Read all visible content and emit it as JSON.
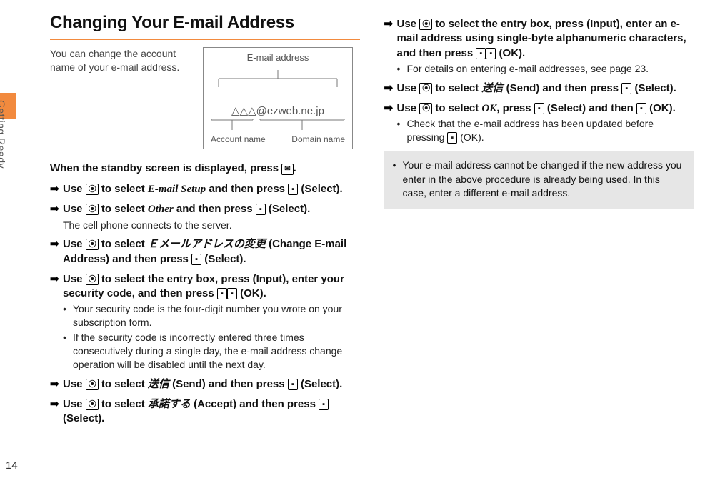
{
  "spine": {
    "section": "Getting Ready",
    "pagenum": "14"
  },
  "title": "Changing Your E-mail Address",
  "intro": "You can change the account name of your e-mail address.",
  "diagram": {
    "heading": "E-mail address",
    "addr": "△△△@ezweb.ne.jp",
    "label_left": "Account name",
    "label_right": "Domain name"
  },
  "leadline_pre": "When the standby screen is displayed, press ",
  "leadline_post": ".",
  "icons": {
    "nav": "⦿",
    "center": "▪",
    "mail": "✉"
  },
  "steps_left": [
    {
      "pre": "Use ",
      "icon": "nav",
      "mid1": " to select ",
      "ital": "E-mail Setup",
      "italClass": "italic-serif",
      "mid2": " and then  press ",
      "icon2": "center",
      "post": " (Select)."
    },
    {
      "pre": "Use ",
      "icon": "nav",
      "mid1": " to select ",
      "ital": "Other",
      "italClass": "italic-serif",
      "mid2": " and then press ",
      "icon2": "center",
      "post": " (Select).",
      "sub_plain": "The cell phone connects to the server."
    },
    {
      "pre": "Use ",
      "icon": "nav",
      "mid1": " to select ",
      "ital": "Ｅメールアドレスの変更",
      "italClass": "italic-sans",
      "paren": " (Change E-mail Address)",
      "mid2": " and then press ",
      "icon2": "center",
      "post": " (Select)."
    },
    {
      "pre": "Use ",
      "icon": "nav",
      "mid1": " to select the entry box, press ",
      "icon2": "center",
      "mid2": " (Input), enter your security code, and then press ",
      "icon3": "center",
      "post": " (OK).",
      "sub_bullets": [
        "Your security code is the four-digit number you wrote on your subscription form.",
        "If the security code is incorrectly entered three times consecutively during a single day, the e-mail address change operation will be disabled until the next day."
      ]
    },
    {
      "pre": "Use ",
      "icon": "nav",
      "mid1": " to select ",
      "ital": "送信",
      "italClass": "italic-sans",
      "paren": " (Send)",
      "mid2": " and then press ",
      "icon2": "center",
      "post": " (Select)."
    },
    {
      "pre": "Use ",
      "icon": "nav",
      "mid1": " to select ",
      "ital": "承諾する",
      "italClass": "italic-sans",
      "paren": " (Accept)",
      "mid2": " and then press ",
      "icon2": "center",
      "post": " (Select)."
    }
  ],
  "steps_right": [
    {
      "pre": "Use ",
      "icon": "nav",
      "mid1": " to select the entry box, press ",
      "icon2": "center",
      "mid2": " (Input), enter an e-mail address using single-byte alphanumeric characters, and then press ",
      "icon3": "center",
      "post": " (OK).",
      "sub_bullets": [
        "For details on entering e-mail addresses, see page 23."
      ]
    },
    {
      "pre": "Use ",
      "icon": "nav",
      "mid1": " to select ",
      "ital": "送信",
      "italClass": "italic-sans",
      "paren": " (Send)",
      "mid2": " and then press ",
      "icon2": "center",
      "post": " (Select)."
    },
    {
      "pre": "Use ",
      "icon": "nav",
      "mid1": " to select ",
      "ital": "OK",
      "italClass": "italic-serif",
      "mid2": ", press ",
      "icon2": "center",
      "mid3": " (Select) and then ",
      "icon3": "center",
      "post": " (OK).",
      "sub_bullets": [
        "Check that the e-mail address has been updated before pressing [■] (OK)."
      ],
      "sub_has_icon": true,
      "sub_render": "Check that the e-mail address has been updated before pressing "
    }
  ],
  "note": "Your e-mail address cannot be changed if the new address you enter in the above procedure is already being used. In this case, enter a different e-mail address."
}
